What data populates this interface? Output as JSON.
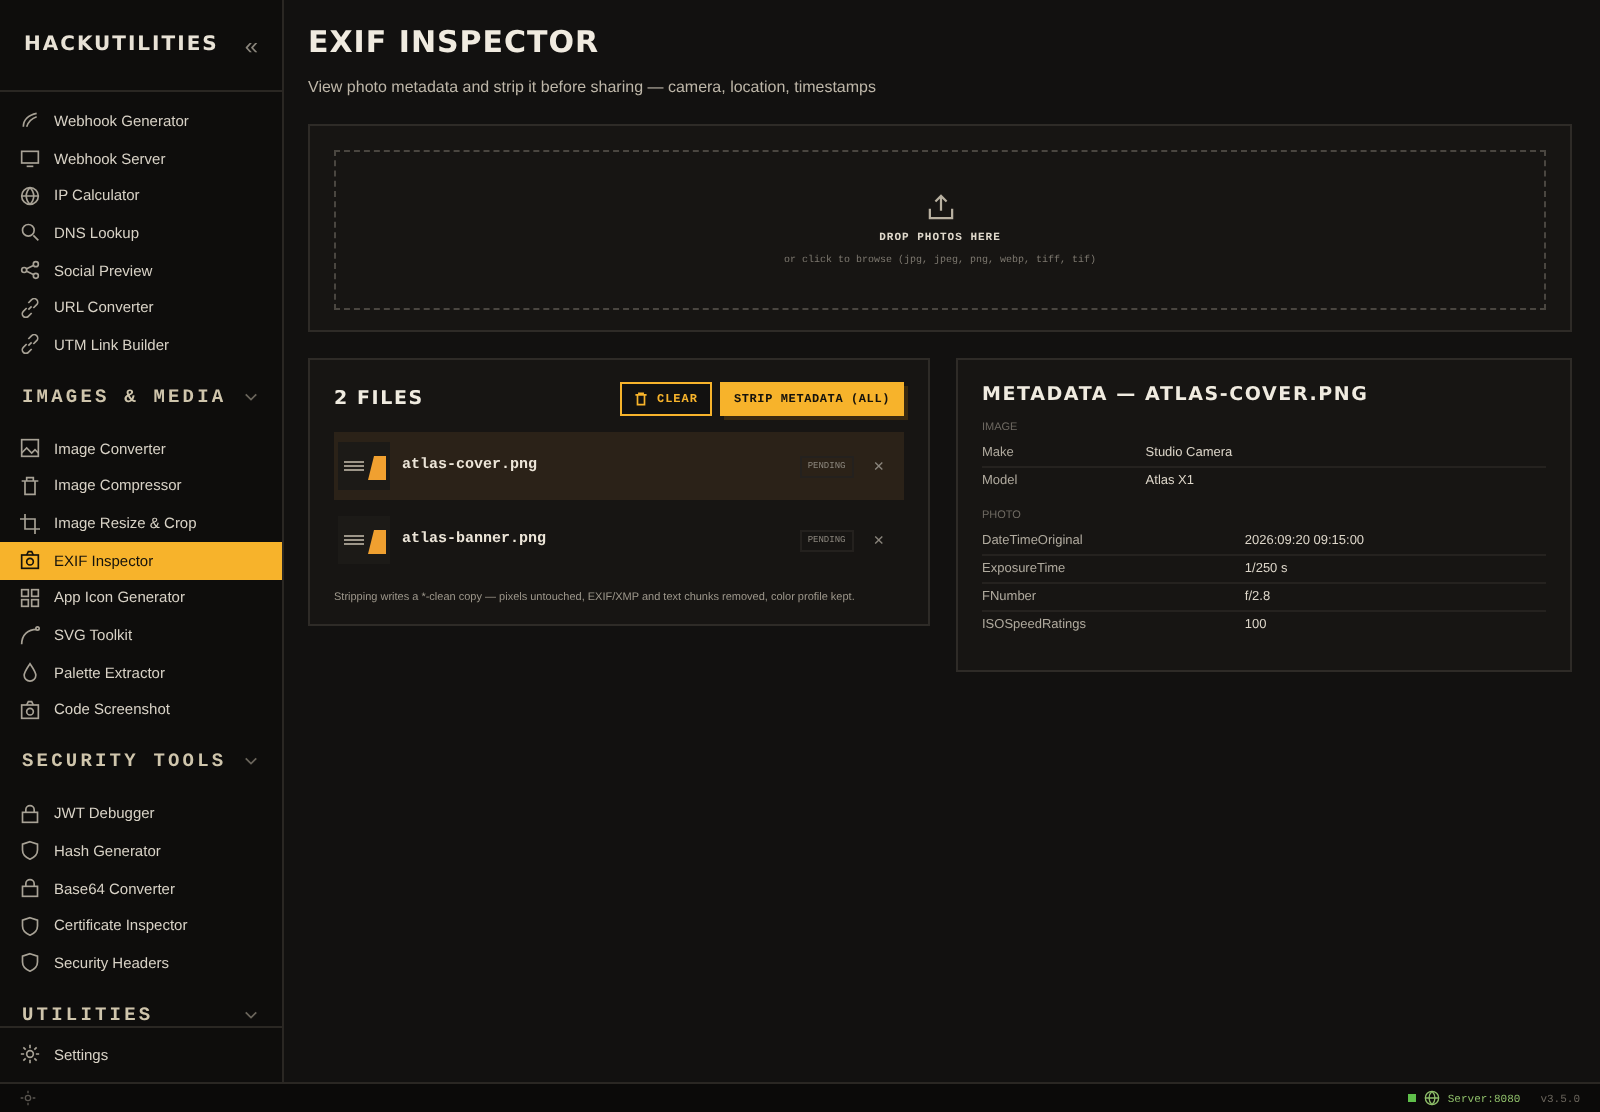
{
  "sidebar": {
    "brand": "HACKUTILITIES",
    "collapse": "«",
    "groups": [
      {
        "items": [
          {
            "label": "Webhook Generator",
            "selected": false
          },
          {
            "label": "Webhook Server",
            "selected": false
          },
          {
            "label": "IP Calculator",
            "selected": false
          },
          {
            "label": "DNS Lookup",
            "selected": false
          },
          {
            "label": "Social Preview",
            "selected": false
          },
          {
            "label": "URL Converter",
            "selected": false
          },
          {
            "label": "UTM Link Builder",
            "selected": false
          }
        ]
      },
      {
        "title": "IMAGES & MEDIA",
        "items": [
          {
            "label": "Image Converter",
            "selected": false
          },
          {
            "label": "Image Compressor",
            "selected": false
          },
          {
            "label": "Image Resize & Crop",
            "selected": false
          },
          {
            "label": "EXIF Inspector",
            "selected": true
          },
          {
            "label": "App Icon Generator",
            "selected": false
          },
          {
            "label": "SVG Toolkit",
            "selected": false
          },
          {
            "label": "Palette Extractor",
            "selected": false
          },
          {
            "label": "Code Screenshot",
            "selected": false
          }
        ]
      },
      {
        "title": "SECURITY TOOLS",
        "items": [
          {
            "label": "JWT Debugger",
            "selected": false
          },
          {
            "label": "Hash Generator",
            "selected": false
          },
          {
            "label": "Base64 Converter",
            "selected": false
          },
          {
            "label": "Certificate Inspector",
            "selected": false
          },
          {
            "label": "Security Headers",
            "selected": false
          }
        ]
      },
      {
        "title": "UTILITIES"
      }
    ],
    "footer": {
      "label": "Settings"
    }
  },
  "page": {
    "title": "EXIF INSPECTOR",
    "subtitle": "View photo metadata and strip it before sharing — camera, location, timestamps"
  },
  "dropzone": {
    "title": "DROP PHOTOS HERE",
    "hint": "or click to browse (jpg, jpeg, png, webp, tiff, tif)"
  },
  "files": {
    "title": "2 FILES",
    "clear": "CLEAR",
    "strip": "STRIP METADATA (ALL)",
    "items": [
      {
        "name": "atlas-cover.png",
        "status": "PENDING",
        "remove": "×",
        "selected": true
      },
      {
        "name": "atlas-banner.png",
        "status": "PENDING",
        "remove": "×",
        "selected": false
      }
    ],
    "note": "Stripping writes a *-clean copy — pixels untouched, EXIF/XMP and text chunks removed, color profile kept."
  },
  "metadata": {
    "title": "METADATA — ATLAS-COVER.PNG",
    "groups": [
      {
        "label": "IMAGE",
        "rows": [
          {
            "key": "Make",
            "value": "Studio Camera"
          },
          {
            "key": "Model",
            "value": "Atlas X1"
          }
        ]
      },
      {
        "label": "PHOTO",
        "rows": [
          {
            "key": "DateTimeOriginal",
            "value": "2026:09:20 09:15:00"
          },
          {
            "key": "ExposureTime",
            "value": "1/250 s"
          },
          {
            "key": "FNumber",
            "value": "f/2.8"
          },
          {
            "key": "ISOSpeedRatings",
            "value": "100"
          }
        ]
      }
    ]
  },
  "status_bar": {
    "server": "Server:8080",
    "version": "v3.5.0"
  }
}
